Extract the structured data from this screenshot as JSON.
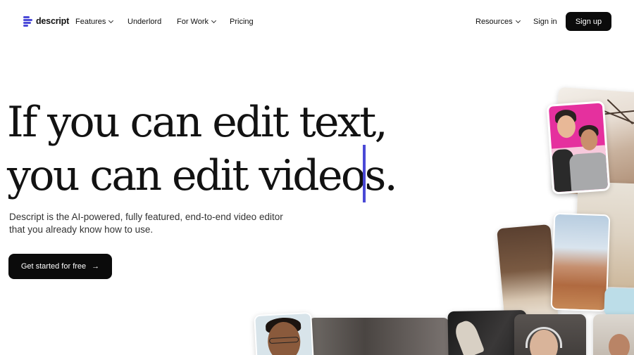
{
  "nav": {
    "logo_text": "descript",
    "items": [
      {
        "label": "Features",
        "has_dropdown": true
      },
      {
        "label": "Underlord",
        "has_dropdown": false
      },
      {
        "label": "For Work",
        "has_dropdown": true
      },
      {
        "label": "Pricing",
        "has_dropdown": false
      }
    ],
    "resources": "Resources",
    "sign_in": "Sign in",
    "sign_up": "Sign up"
  },
  "hero": {
    "headline_line1": "If you can edit text,",
    "headline_line2": "you can edit videos.",
    "subtitle_line1": "Descript is the AI-powered, fully featured, end-to-end video editor",
    "subtitle_line2": "that you already know how to use.",
    "cta": "Get started for free",
    "cta_icon": "arrow-right-icon"
  },
  "colors": {
    "accent": "#4a49d6",
    "button_bg": "#0b0b0b",
    "text": "#121212"
  }
}
